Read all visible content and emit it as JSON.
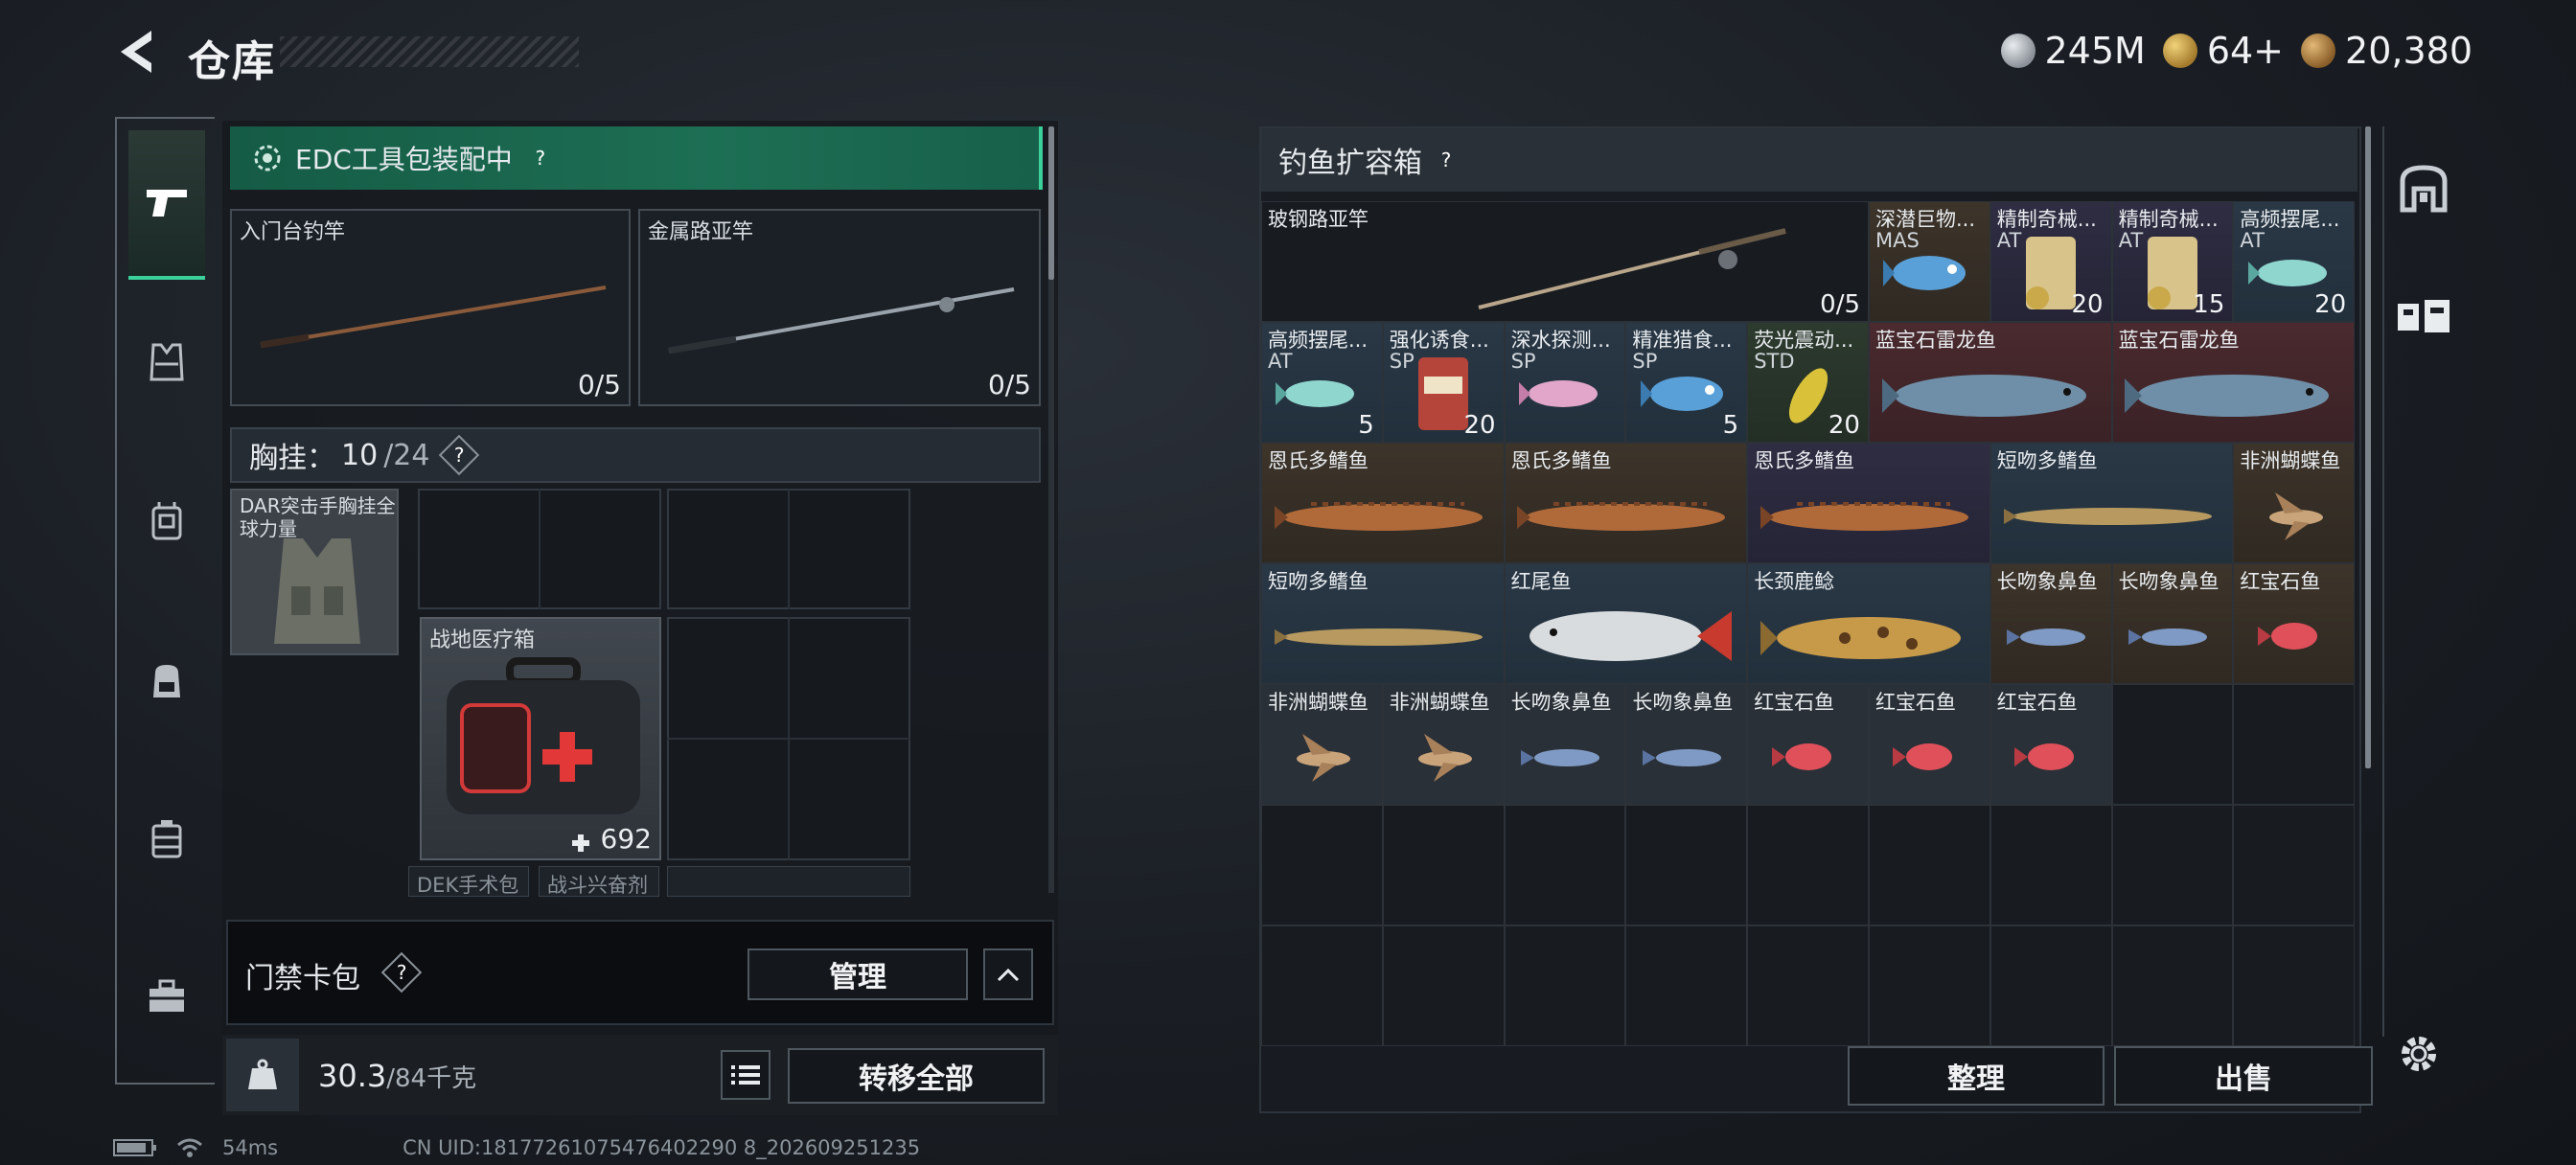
{
  "header": {
    "title": "仓库",
    "currencies": [
      {
        "icon": "silver-coin-icon",
        "value": "245M"
      },
      {
        "icon": "gold-token-icon",
        "value": "64+"
      },
      {
        "icon": "bronze-coin-icon",
        "value": "20,380"
      }
    ]
  },
  "left_nav": {
    "items": [
      {
        "name": "pistol-icon",
        "active": true
      },
      {
        "name": "armor-icon",
        "active": false
      },
      {
        "name": "chest-rig-icon",
        "active": false
      },
      {
        "name": "backpack-icon",
        "active": false
      },
      {
        "name": "container-icon",
        "active": false
      },
      {
        "name": "toolbox-icon",
        "active": false
      }
    ]
  },
  "loadout": {
    "kit_banner": "EDC工具包装配中",
    "rod_slot_1": {
      "label": "入门台钓竿",
      "count": "0/5"
    },
    "rod_slot_2": {
      "label": "金属路亚竿",
      "count": "0/5"
    },
    "chest": {
      "label": "胸挂：",
      "used": "10",
      "capacity": "/24"
    },
    "vest_item": {
      "label": "DAR突击手胸挂全球力量"
    },
    "med_item": {
      "label": "战地医疗箱",
      "durability": "692"
    },
    "small_items": [
      "DEK手术包",
      "战斗兴奋剂"
    ]
  },
  "card_pack": {
    "label": "门禁卡包",
    "manage_button": "管理"
  },
  "weight": {
    "current": "30.3",
    "max": "/84千克"
  },
  "transfer_all_button": "转移全部",
  "box": {
    "title": "钓鱼扩容箱",
    "cells": [
      {
        "name": "玻钢路亚竿",
        "tag": "",
        "qty": "0/5"
      },
      {
        "name": "深潜巨物...",
        "tag": "MAS",
        "qty": ""
      },
      {
        "name": "精制奇械...",
        "tag": "AT",
        "qty": "20"
      },
      {
        "name": "精制奇械...",
        "tag": "AT",
        "qty": "15"
      },
      {
        "name": "高频摆尾...",
        "tag": "AT",
        "qty": "20"
      },
      {
        "name": "高频摆尾...",
        "tag": "AT",
        "qty": "5"
      },
      {
        "name": "强化诱食...",
        "tag": "SP",
        "qty": "20"
      },
      {
        "name": "深水探测...",
        "tag": "SP",
        "qty": ""
      },
      {
        "name": "精准猎食...",
        "tag": "SP",
        "qty": "5"
      },
      {
        "name": "荧光震动...",
        "tag": "STD",
        "qty": "20"
      },
      {
        "name": "蓝宝石雷龙鱼",
        "tag": "",
        "qty": ""
      },
      {
        "name": "蓝宝石雷龙鱼",
        "tag": "",
        "qty": ""
      },
      {
        "name": "恩氏多鳍鱼",
        "tag": "",
        "qty": ""
      },
      {
        "name": "恩氏多鳍鱼",
        "tag": "",
        "qty": ""
      },
      {
        "name": "恩氏多鳍鱼",
        "tag": "",
        "qty": ""
      },
      {
        "name": "短吻多鳍鱼",
        "tag": "",
        "qty": ""
      },
      {
        "name": "非洲蝴蝶鱼",
        "tag": "",
        "qty": ""
      },
      {
        "name": "短吻多鳍鱼",
        "tag": "",
        "qty": ""
      },
      {
        "name": "红尾鱼",
        "tag": "",
        "qty": ""
      },
      {
        "name": "长颈鹿鲶",
        "tag": "",
        "qty": ""
      },
      {
        "name": "长吻象鼻鱼",
        "tag": "",
        "qty": ""
      },
      {
        "name": "长吻象鼻鱼",
        "tag": "",
        "qty": ""
      },
      {
        "name": "红宝石鱼",
        "tag": "",
        "qty": ""
      },
      {
        "name": "非洲蝴蝶鱼",
        "tag": "",
        "qty": ""
      },
      {
        "name": "非洲蝴蝶鱼",
        "tag": "",
        "qty": ""
      },
      {
        "name": "长吻象鼻鱼",
        "tag": "",
        "qty": ""
      },
      {
        "name": "长吻象鼻鱼",
        "tag": "",
        "qty": ""
      },
      {
        "name": "红宝石鱼",
        "tag": "",
        "qty": ""
      },
      {
        "name": "红宝石鱼",
        "tag": "",
        "qty": ""
      },
      {
        "name": "红宝石鱼",
        "tag": "",
        "qty": ""
      }
    ],
    "sort_button": "整理",
    "sell_button": "出售"
  },
  "status": {
    "ping": "54ms",
    "uid": "CN UID:18177261075476402290 8_202609251235"
  },
  "colors": {
    "accent": "#3ad19a",
    "banner": "#1d6f54"
  }
}
